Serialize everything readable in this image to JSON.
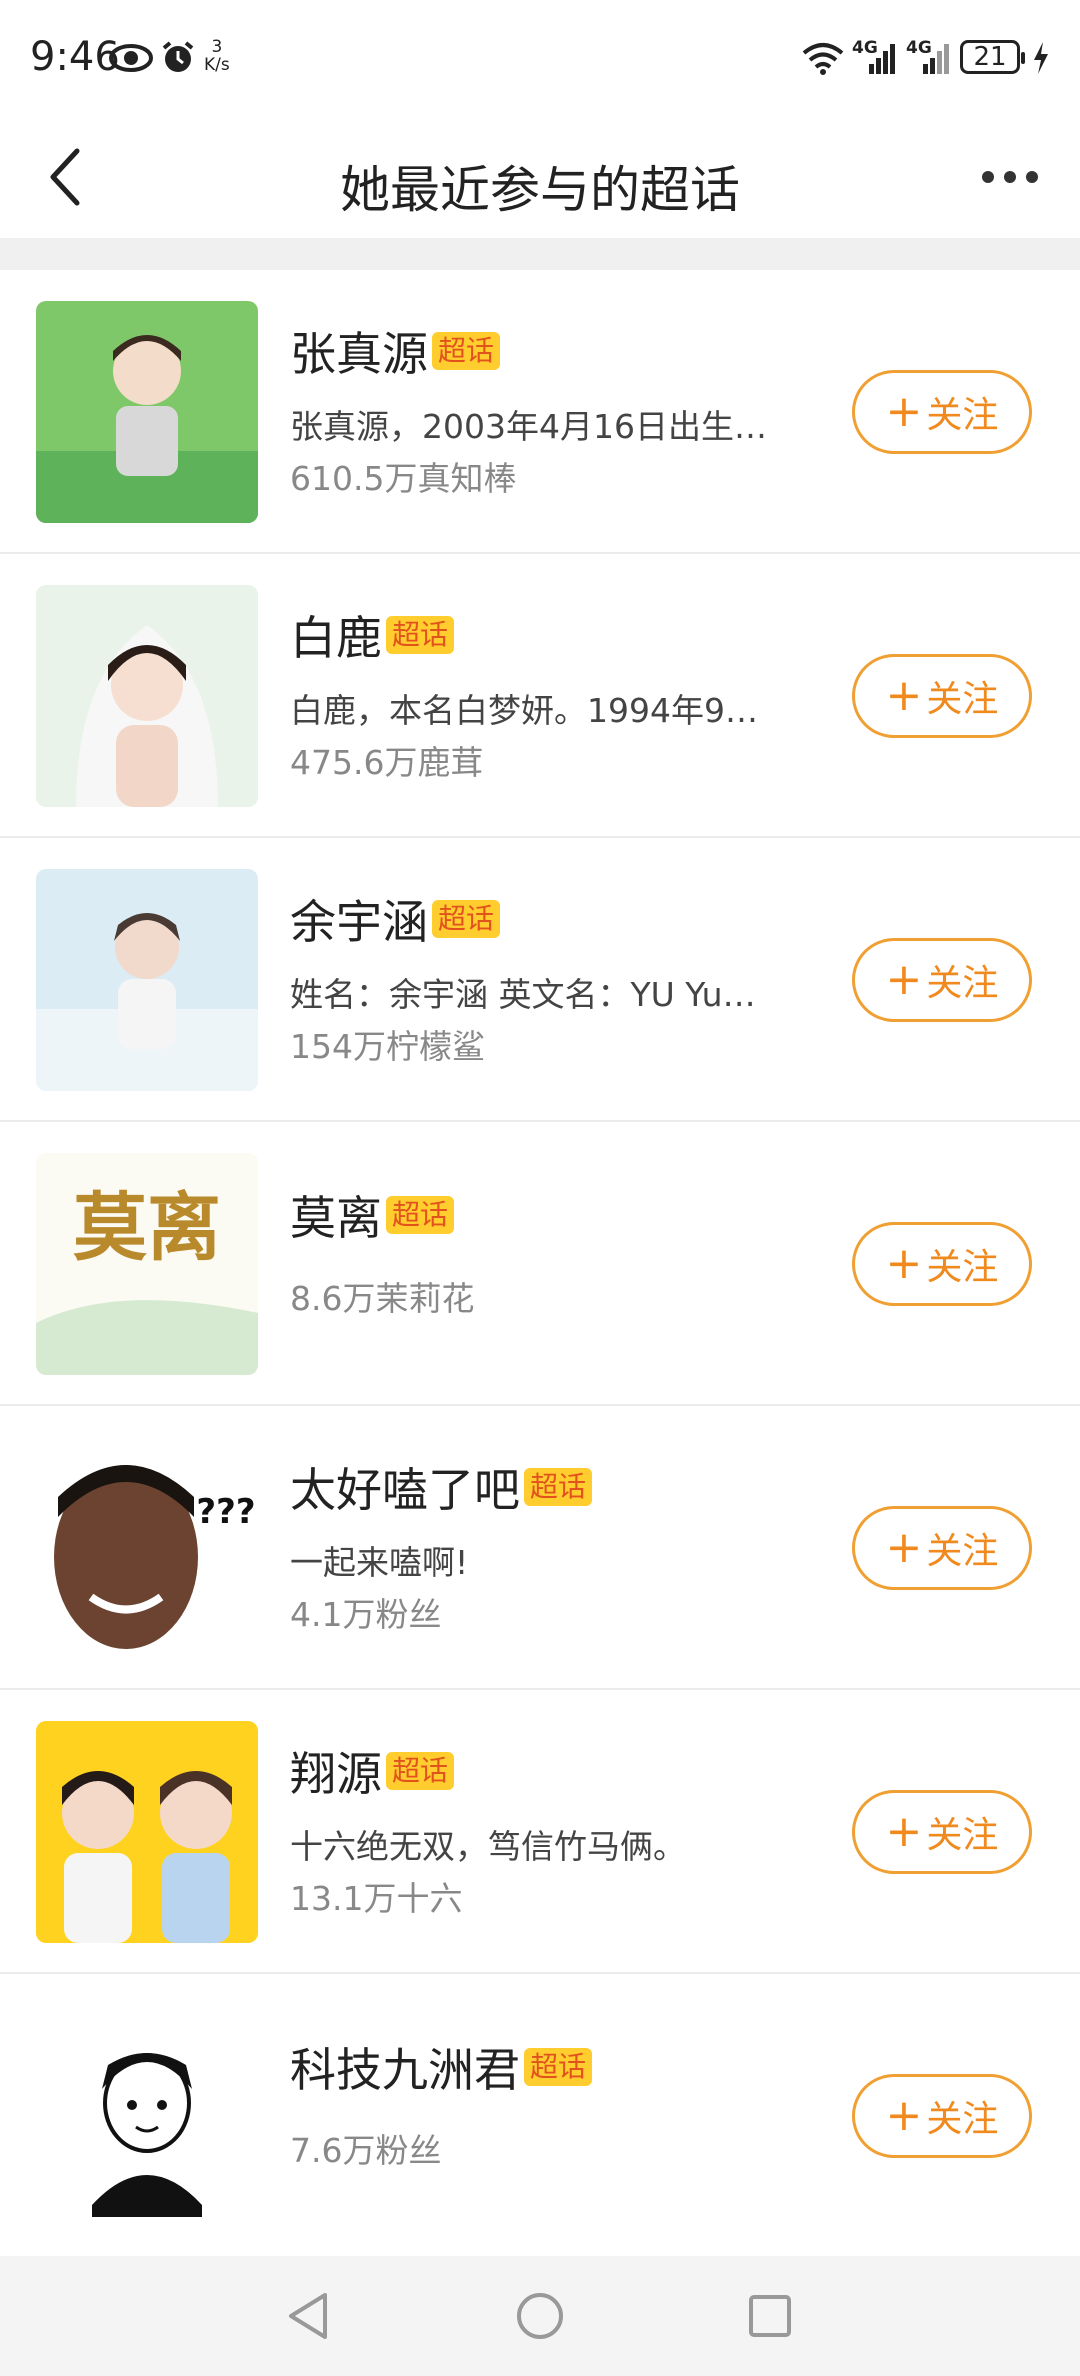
{
  "status_bar": {
    "time": "9:46",
    "net_speed_value": "3",
    "net_speed_unit": "K/s",
    "net_label_1": "4G",
    "net_label_2": "4G",
    "battery": "21"
  },
  "header": {
    "title": "她最近参与的超话"
  },
  "items": [
    {
      "name": "张真源",
      "badge": "超话",
      "desc": "张真源，2003年4月16日出生…",
      "fans": "610.5万真知棒",
      "follow": "关注",
      "thumb_icon": "portrait-thumbnail"
    },
    {
      "name": "白鹿",
      "badge": "超话",
      "desc": "白鹿，本名白梦妍。1994年9…",
      "fans": "475.6万鹿茸",
      "follow": "关注",
      "thumb_icon": "portrait-thumbnail"
    },
    {
      "name": "余宇涵",
      "badge": "超话",
      "desc": "姓名：余宇涵 英文名：YU Yu…",
      "fans": "154万柠檬鲨",
      "follow": "关注",
      "thumb_icon": "portrait-thumbnail"
    },
    {
      "name": "莫离",
      "badge": "超话",
      "desc": "",
      "fans": "8.6万茉莉花",
      "follow": "关注",
      "thumb_icon": "calligraphy-thumbnail",
      "thumb_text": "莫离"
    },
    {
      "name": "太好嗑了吧",
      "badge": "超话",
      "desc": "一起来嗑啊!",
      "fans": "4.1万粉丝",
      "follow": "关注",
      "thumb_icon": "meme-thumbnail",
      "thumb_text": "???"
    },
    {
      "name": "翔源",
      "badge": "超话",
      "desc": "十六绝无双，笃信竹马俩。",
      "fans": "13.1万十六",
      "follow": "关注",
      "thumb_icon": "duo-portrait-thumbnail"
    },
    {
      "name": "科技九洲君",
      "badge": "超话",
      "desc": "",
      "fans": "7.6万粉丝",
      "follow": "关注",
      "thumb_icon": "cartoon-avatar-thumbnail"
    }
  ],
  "nav": {
    "back_icon": "triangle-back-icon",
    "home_icon": "circle-home-icon",
    "recent_icon": "square-recent-icon"
  },
  "colors": {
    "accent": "#f08a1e",
    "badge_bg": "#ffcd2e",
    "badge_text": "#e2521d"
  }
}
